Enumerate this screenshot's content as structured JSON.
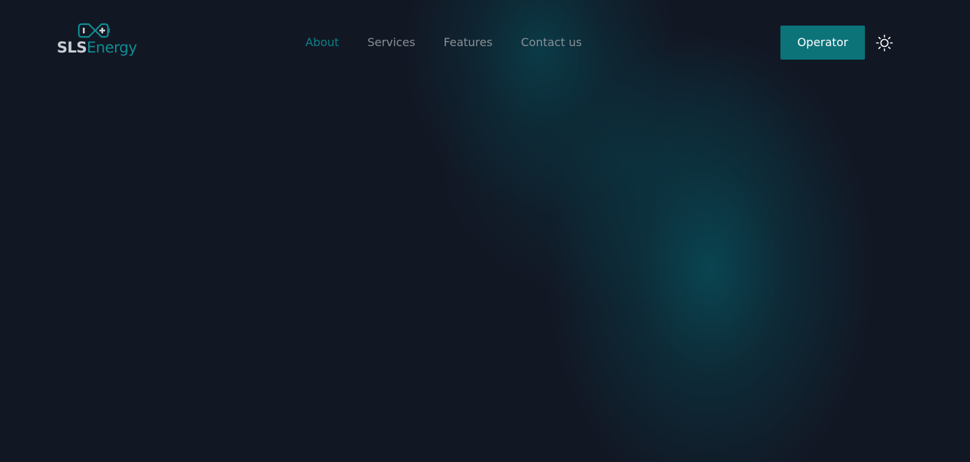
{
  "brand": {
    "name_part1": "SLS",
    "name_part2": "Energy",
    "logo_icon": "battery-icon",
    "accent_color": "#0e8188"
  },
  "nav": {
    "items": [
      {
        "label": "About",
        "active": true
      },
      {
        "label": "Services",
        "active": false
      },
      {
        "label": "Features",
        "active": false
      },
      {
        "label": "Contact us",
        "active": false
      }
    ]
  },
  "header": {
    "operator_label": "Operator",
    "operator_color": "#0c7379",
    "theme_icon": "sun-icon"
  },
  "page": {
    "background_color": "#121724"
  }
}
